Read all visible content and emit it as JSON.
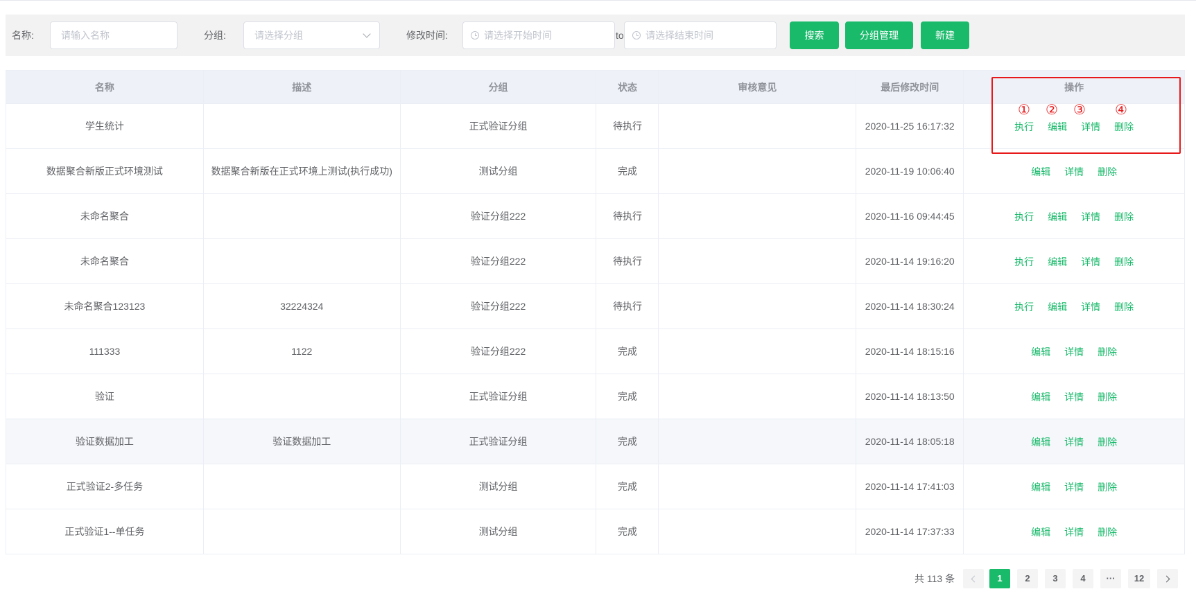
{
  "filters": {
    "name_label": "名称:",
    "name_placeholder": "请输入名称",
    "group_label": "分组:",
    "group_placeholder": "请选择分组",
    "time_label": "修改时间:",
    "start_placeholder": "请选择开始时间",
    "to_text": "to",
    "end_placeholder": "请选择结束时间",
    "search_button": "搜索",
    "group_manage_button": "分组管理",
    "new_button": "新建"
  },
  "table": {
    "headers": [
      "名称",
      "描述",
      "分组",
      "状态",
      "审核意见",
      "最后修改时间",
      "操作"
    ],
    "rows": [
      {
        "name": "学生统计",
        "desc": "",
        "group": "正式验证分组",
        "status": "待执行",
        "review": "",
        "time": "2020-11-25 16:17:32",
        "actions": [
          "执行",
          "编辑",
          "详情",
          "删除"
        ]
      },
      {
        "name": "数据聚合新版正式环境测试",
        "desc": "数据聚合新版在正式环境上测试(执行成功)",
        "group": "测试分组",
        "status": "完成",
        "review": "",
        "time": "2020-11-19 10:06:40",
        "actions": [
          "编辑",
          "详情",
          "删除"
        ]
      },
      {
        "name": "未命名聚合",
        "desc": "",
        "group": "验证分组222",
        "status": "待执行",
        "review": "",
        "time": "2020-11-16 09:44:45",
        "actions": [
          "执行",
          "编辑",
          "详情",
          "删除"
        ]
      },
      {
        "name": "未命名聚合",
        "desc": "",
        "group": "验证分组222",
        "status": "待执行",
        "review": "",
        "time": "2020-11-14 19:16:20",
        "actions": [
          "执行",
          "编辑",
          "详情",
          "删除"
        ]
      },
      {
        "name": "未命名聚合123123",
        "desc": "32224324",
        "group": "验证分组222",
        "status": "待执行",
        "review": "",
        "time": "2020-11-14 18:30:24",
        "actions": [
          "执行",
          "编辑",
          "详情",
          "删除"
        ]
      },
      {
        "name": "111333",
        "desc": "1122",
        "group": "验证分组222",
        "status": "完成",
        "review": "",
        "time": "2020-11-14 18:15:16",
        "actions": [
          "编辑",
          "详情",
          "删除"
        ]
      },
      {
        "name": "验证",
        "desc": "",
        "group": "正式验证分组",
        "status": "完成",
        "review": "",
        "time": "2020-11-14 18:13:50",
        "actions": [
          "编辑",
          "详情",
          "删除"
        ]
      },
      {
        "name": "验证数据加工",
        "desc": "验证数据加工",
        "group": "正式验证分组",
        "status": "完成",
        "review": "",
        "time": "2020-11-14 18:05:18",
        "actions": [
          "编辑",
          "详情",
          "删除"
        ]
      },
      {
        "name": "正式验证2-多任务",
        "desc": "",
        "group": "测试分组",
        "status": "完成",
        "review": "",
        "time": "2020-11-14 17:41:03",
        "actions": [
          "编辑",
          "详情",
          "删除"
        ]
      },
      {
        "name": "正式验证1--单任务",
        "desc": "",
        "group": "测试分组",
        "status": "完成",
        "review": "",
        "time": "2020-11-14 17:37:33",
        "actions": [
          "编辑",
          "详情",
          "删除"
        ]
      }
    ],
    "highlighted_row": 7
  },
  "annotations": {
    "numbers": [
      "①",
      "②",
      "③",
      "④"
    ],
    "color": "#e8191b"
  },
  "pagination": {
    "total_text": "共 113 条",
    "pages": [
      "1",
      "2",
      "3",
      "4",
      "···",
      "12"
    ],
    "current": "1"
  },
  "colors": {
    "accent": "#1aba6b",
    "header_bg": "#eef1f8",
    "filter_bg": "#f2f2f2"
  },
  "icons": {
    "date_input": "clock-icon",
    "select": "chevron-down-icon",
    "prev": "chevron-left-icon",
    "next": "chevron-right-icon"
  }
}
